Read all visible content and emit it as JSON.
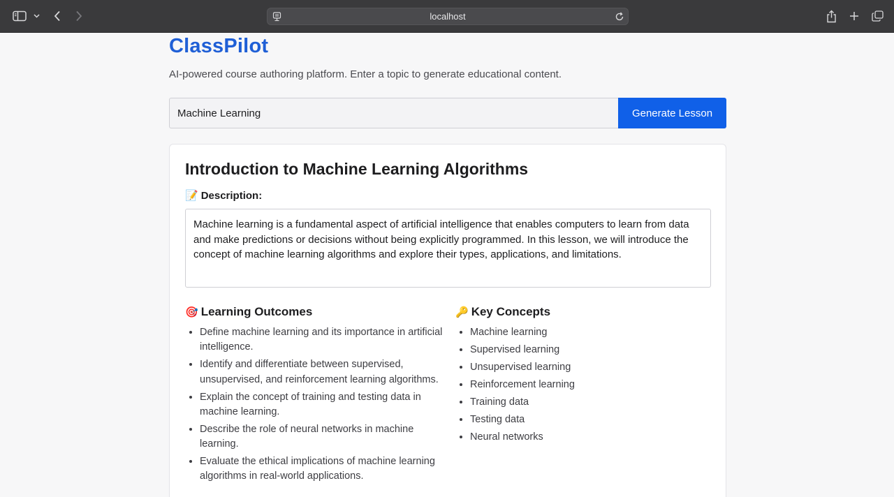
{
  "browser": {
    "url": "localhost"
  },
  "app": {
    "name": "ClassPilot",
    "tagline": "AI-powered course authoring platform. Enter a topic to generate educational content."
  },
  "topic_input": {
    "value": "Machine Learning"
  },
  "generate_button": {
    "label": "Generate Lesson"
  },
  "lesson": {
    "title": "Introduction to Machine Learning Algorithms",
    "description_heading": "Description:",
    "description_emoji": "📝",
    "description": "Machine learning is a fundamental aspect of artificial intelligence that enables computers to learn from data and make predictions or decisions without being explicitly programmed. In this lesson, we will introduce the concept of machine learning algorithms and explore their types, applications, and limitations.",
    "outcomes_heading": "Learning Outcomes",
    "outcomes_emoji": "🎯",
    "outcomes": [
      "Define machine learning and its importance in artificial intelligence.",
      "Identify and differentiate between supervised, unsupervised, and reinforcement learning algorithms.",
      "Explain the concept of training and testing data in machine learning.",
      "Describe the role of neural networks in machine learning.",
      "Evaluate the ethical implications of machine learning algorithms in real-world applications."
    ],
    "concepts_heading": "Key Concepts",
    "concepts_emoji": "🔑",
    "concepts": [
      "Machine learning",
      "Supervised learning",
      "Unsupervised learning",
      "Reinforcement learning",
      "Training data",
      "Testing data",
      "Neural networks"
    ]
  },
  "colors": {
    "brand": "#1f5fd6",
    "button": "#1060e8"
  }
}
